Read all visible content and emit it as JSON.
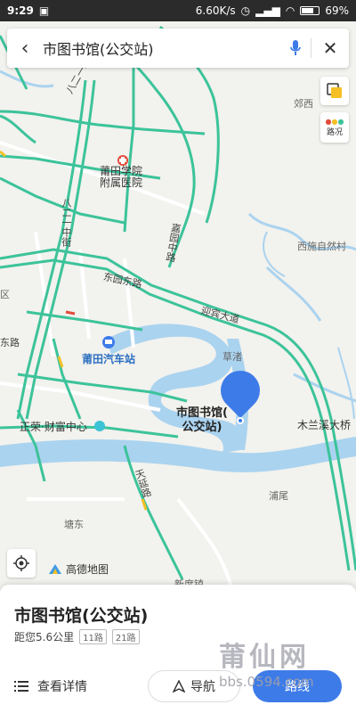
{
  "status_bar": {
    "time": "9:29",
    "net_speed": "6.60K/s",
    "battery": "69%"
  },
  "search": {
    "query": "市图书馆(公交站)"
  },
  "traffic_button": {
    "label": "路况"
  },
  "map_labels": {
    "hospital": "莆田学院\n附属医院",
    "bus_station": "莆田汽车站",
    "poi": "市图书馆(\n公交站)",
    "zhengrong": "正荣·财富中心",
    "caozhu": "草渚",
    "puwei": "浦尾",
    "tangdong": "塘东",
    "xishi": "西施自然村",
    "bridge": "木兰溪大桥",
    "jiaoxi": "郊西",
    "xinduzhen": "新度镇",
    "qu": "区"
  },
  "road_labels": {
    "bayi_north": "八二一北街",
    "bayi_middle": "八二一中街",
    "jiayuan": "嘉园中路",
    "dongyuan": "东园东路",
    "yingbin": "迎宾大道",
    "tianyan": "天延路",
    "dong_road": "东路"
  },
  "map_logo": {
    "text": "高德地图"
  },
  "place": {
    "name": "市图书馆(公交站)",
    "distance": "距您5.6公里",
    "routes": [
      "11路",
      "21路"
    ]
  },
  "actions": {
    "detail": "查看详情",
    "navigate": "导航",
    "route": "路线"
  },
  "watermark": {
    "name": "莆仙网",
    "url": "bbs.0594.com"
  },
  "colors": {
    "road": "#3cc39a",
    "river": "#aad3ef",
    "accent": "#3d7be8"
  }
}
